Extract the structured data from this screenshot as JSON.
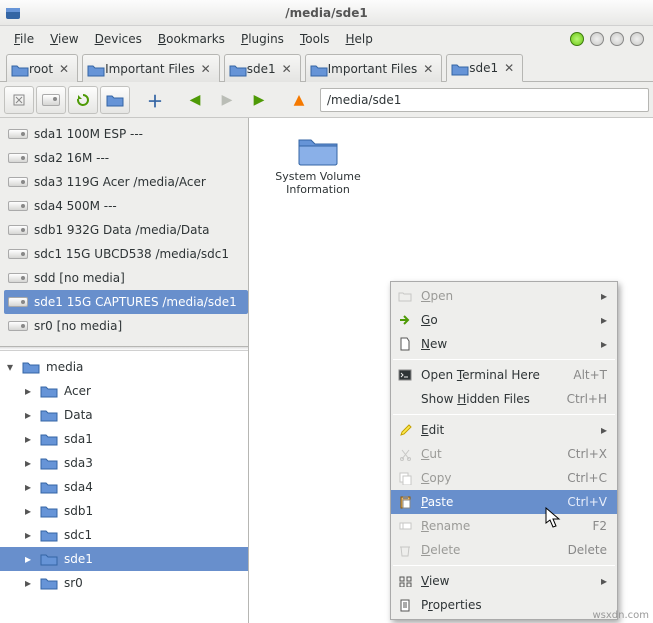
{
  "window": {
    "title": "/media/sde1"
  },
  "menu": {
    "items": [
      "File",
      "View",
      "Devices",
      "Bookmarks",
      "Plugins",
      "Tools",
      "Help"
    ]
  },
  "status_dots": [
    "green",
    "grey",
    "grey",
    "grey"
  ],
  "tabs": [
    {
      "label": "root",
      "active": false
    },
    {
      "label": "Important Files",
      "active": false
    },
    {
      "label": "sde1",
      "active": false
    },
    {
      "label": "Important Files",
      "active": false
    },
    {
      "label": "sde1",
      "active": true
    }
  ],
  "path": {
    "value": "/media/sde1"
  },
  "devices": [
    {
      "label": "sda1 100M ESP ---",
      "selected": false
    },
    {
      "label": "sda2 16M ---",
      "selected": false
    },
    {
      "label": "sda3 119G Acer /media/Acer",
      "selected": false
    },
    {
      "label": "sda4 500M ---",
      "selected": false
    },
    {
      "label": "sdb1 932G Data /media/Data",
      "selected": false
    },
    {
      "label": "sdc1 15G UBCD538 /media/sdc1",
      "selected": false
    },
    {
      "label": "sdd [no media]",
      "selected": false
    },
    {
      "label": "sde1 15G CAPTURES /media/sde1",
      "selected": true
    },
    {
      "label": "sr0 [no media]",
      "selected": false
    }
  ],
  "tree": {
    "root": {
      "label": "media",
      "expanded": true
    },
    "children": [
      {
        "label": "Acer",
        "selected": false
      },
      {
        "label": "Data",
        "selected": false
      },
      {
        "label": "sda1",
        "selected": false
      },
      {
        "label": "sda3",
        "selected": false
      },
      {
        "label": "sda4",
        "selected": false
      },
      {
        "label": "sdb1",
        "selected": false
      },
      {
        "label": "sdc1",
        "selected": false
      },
      {
        "label": "sde1",
        "selected": true
      },
      {
        "label": "sr0",
        "selected": false
      }
    ]
  },
  "folderview": {
    "items": [
      {
        "name_line1": "System Volume",
        "name_line2": "Information"
      }
    ]
  },
  "context_menu": {
    "items": [
      {
        "id": "open",
        "label": "Open",
        "underline": 0,
        "disabled": true,
        "submenu": true,
        "icon": "folder-open"
      },
      {
        "id": "go",
        "label": "Go",
        "underline": 0,
        "disabled": false,
        "submenu": true,
        "icon": "go-arrow"
      },
      {
        "id": "new",
        "label": "New",
        "underline": 0,
        "disabled": false,
        "submenu": true,
        "icon": "file-new"
      },
      {
        "sep": true
      },
      {
        "id": "terminal",
        "label": "Open Terminal Here",
        "underline": 5,
        "disabled": false,
        "accel": "Alt+T",
        "icon": "terminal"
      },
      {
        "id": "hidden",
        "label": "Show Hidden Files",
        "underline": 5,
        "disabled": false,
        "accel": "Ctrl+H",
        "icon": ""
      },
      {
        "sep": true
      },
      {
        "id": "edit",
        "label": "Edit",
        "underline": 0,
        "disabled": false,
        "submenu": true,
        "icon": "edit"
      },
      {
        "id": "cut",
        "label": "Cut",
        "underline": 0,
        "disabled": true,
        "accel": "Ctrl+X",
        "icon": "cut"
      },
      {
        "id": "copy",
        "label": "Copy",
        "underline": 0,
        "disabled": true,
        "accel": "Ctrl+C",
        "icon": "copy"
      },
      {
        "id": "paste",
        "label": "Paste",
        "underline": 0,
        "disabled": false,
        "accel": "Ctrl+V",
        "icon": "paste",
        "highlight": true
      },
      {
        "id": "rename",
        "label": "Rename",
        "underline": 0,
        "disabled": true,
        "accel": "F2",
        "icon": "rename"
      },
      {
        "id": "delete",
        "label": "Delete",
        "underline": 0,
        "disabled": true,
        "accel": "Delete",
        "icon": "delete"
      },
      {
        "sep": true
      },
      {
        "id": "viewm",
        "label": "View",
        "underline": 0,
        "disabled": false,
        "submenu": true,
        "icon": "view"
      },
      {
        "id": "properties",
        "label": "Properties",
        "underline": 1,
        "disabled": false,
        "icon": "properties"
      }
    ]
  },
  "watermark": "wsxdn.com"
}
